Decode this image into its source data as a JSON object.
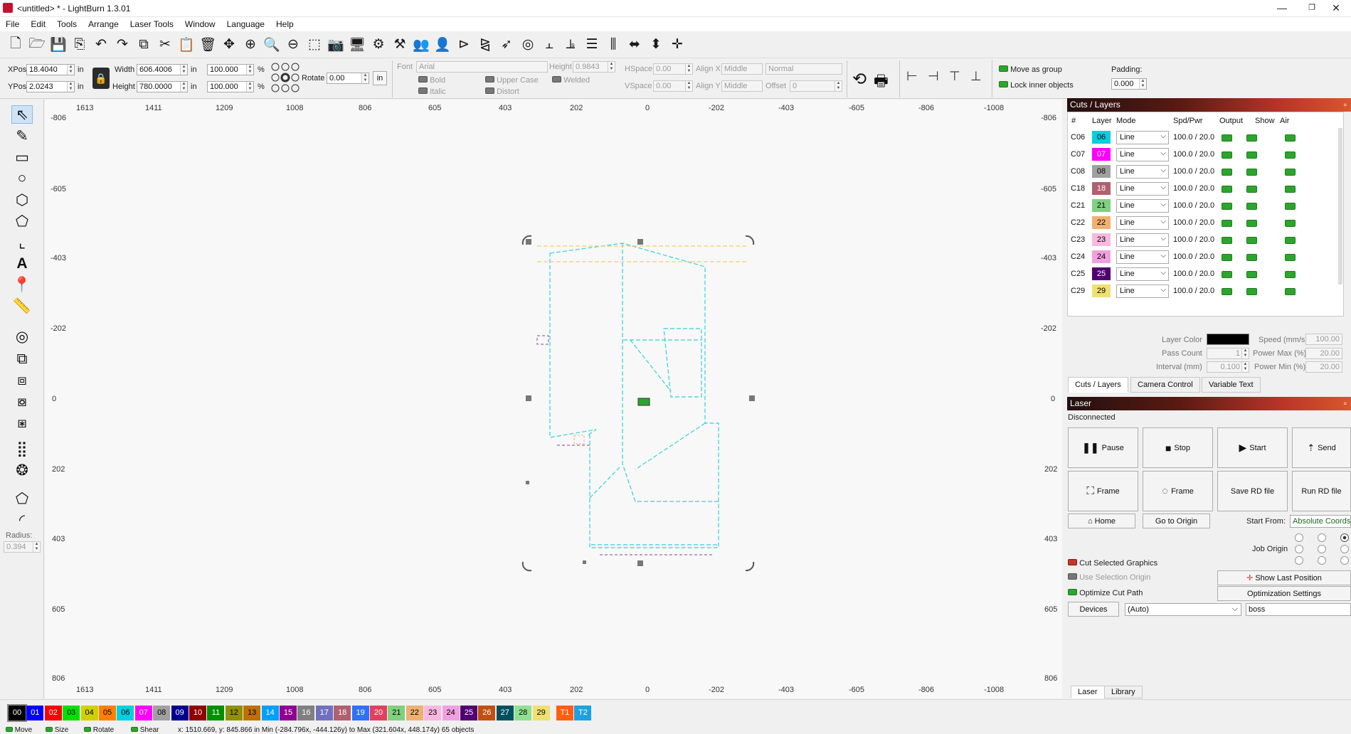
{
  "window": {
    "title": "<untitled> * - LightBurn 1.3.01",
    "minimize": "—",
    "maximize": "❐",
    "close": "✕"
  },
  "menu": [
    "File",
    "Edit",
    "Tools",
    "Arrange",
    "Laser Tools",
    "Window",
    "Language",
    "Help"
  ],
  "toolbar_icons": [
    "new-file-icon",
    "open-folder-icon",
    "save-icon",
    "export-icon",
    "undo-icon",
    "redo-icon",
    "copy-icon",
    "cut-icon",
    "paste-icon",
    "delete-icon",
    "move-icon",
    "zoom-fit-icon",
    "zoom-in-icon",
    "zoom-out-icon",
    "zoom-frame-icon",
    "camera-icon",
    "monitor-icon",
    "settings-icon",
    "tools-icon",
    "group-icon",
    "user-icon",
    "align-icon",
    "mirror-icon",
    "send-icon",
    "target-icon",
    "distribute-left-icon",
    "distribute-right-icon",
    "center-vertical-icon",
    "center-horizontal-icon",
    "equal-width-icon",
    "equal-height-icon",
    "nudge-icon"
  ],
  "props": {
    "xpos_label": "XPos",
    "xpos": "18.4040",
    "xpos_unit": "in",
    "ypos_label": "YPos",
    "ypos": "2.0243",
    "ypos_unit": "in",
    "width_label": "Width",
    "width": "606.4006",
    "width_unit": "in",
    "height_label": "Height",
    "height": "780.0000",
    "height_unit": "in",
    "scale_w": "100.000",
    "scale_h": "100.000",
    "pct": "%",
    "rotate_label": "Rotate",
    "rotate": "0.00",
    "rotate_unit": "in",
    "font_label": "Font",
    "font": "Arial",
    "fheight_label": "Height",
    "fheight": "0.9843",
    "hspace_label": "HSpace",
    "hspace": "0.00",
    "vspace_label": "VSpace",
    "vspace": "0.00",
    "alignx_label": "Align X",
    "alignx": "Middle",
    "aligny_label": "Align Y",
    "aligny": "Middle",
    "normal": "Normal",
    "offset_label": "Offset",
    "offset": "0",
    "bold": "Bold",
    "italic": "Italic",
    "upper": "Upper Case",
    "distort": "Distort",
    "welded": "Welded",
    "move_group": "Move as group",
    "lock_inner": "Lock inner objects",
    "padding_label": "Padding:",
    "padding": "0.000"
  },
  "rulers": {
    "top": [
      "1613",
      "1411",
      "1209",
      "1008",
      "806",
      "605",
      "403",
      "202",
      "0",
      "-202",
      "-403",
      "-605",
      "-806",
      "-1008"
    ],
    "left": [
      "-806",
      "-605",
      "-403",
      "-202",
      "0",
      "202",
      "403",
      "605",
      "806"
    ],
    "right": [
      "-806",
      "-605",
      "-403",
      "-202",
      "0",
      "202",
      "403",
      "605",
      "806"
    ]
  },
  "lefttools": {
    "radius_label": "Radius:",
    "radius": "0.394"
  },
  "cuts": {
    "title": "Cuts / Layers",
    "headers": [
      "#",
      "Layer",
      "Mode",
      "Spd/Pwr",
      "Output",
      "Show",
      "Air"
    ],
    "rows": [
      {
        "id": "C06",
        "num": "06",
        "color": "#00d0e0",
        "mode": "Line",
        "spd": "100.0 / 20.0"
      },
      {
        "id": "C07",
        "num": "07",
        "color": "#ff00ff",
        "mode": "Line",
        "spd": "100.0 / 20.0"
      },
      {
        "id": "C08",
        "num": "08",
        "color": "#a0a0a0",
        "mode": "Line",
        "spd": "100.0 / 20.0"
      },
      {
        "id": "C18",
        "num": "18",
        "color": "#b06070",
        "mode": "Line",
        "spd": "100.0 / 20.0"
      },
      {
        "id": "C21",
        "num": "21",
        "color": "#80d080",
        "mode": "Line",
        "spd": "100.0 / 20.0"
      },
      {
        "id": "C22",
        "num": "22",
        "color": "#f0b070",
        "mode": "Line",
        "spd": "100.0 / 20.0"
      },
      {
        "id": "C23",
        "num": "23",
        "color": "#f8b8e0",
        "mode": "Line",
        "spd": "100.0 / 20.0"
      },
      {
        "id": "C24",
        "num": "24",
        "color": "#f0a0e0",
        "mode": "Line",
        "spd": "100.0 / 20.0"
      },
      {
        "id": "C25",
        "num": "25",
        "color": "#500070",
        "mode": "Line",
        "spd": "100.0 / 20.0"
      },
      {
        "id": "C29",
        "num": "29",
        "color": "#f0e070",
        "mode": "Line",
        "spd": "100.0 / 20.0"
      }
    ],
    "layer_color_label": "Layer Color",
    "pass_label": "Pass Count",
    "pass": "1",
    "interval_label": "Interval (mm)",
    "interval": "0.100",
    "speed_label": "Speed (mm/s)",
    "speed": "100.00",
    "pmax_label": "Power Max (%)",
    "pmax": "20.00",
    "pmin_label": "Power Min (%)",
    "pmin": "20.00"
  },
  "tabs1": [
    "Cuts / Layers",
    "Camera Control",
    "Variable Text"
  ],
  "laser": {
    "title": "Laser",
    "status": "Disconnected",
    "pause": "Pause",
    "stop": "Stop",
    "start": "Start",
    "send": "Send",
    "frame1": "Frame",
    "frame2": "Frame",
    "save_rd": "Save RD file",
    "run_rd": "Run RD file",
    "home": "Home",
    "go_origin": "Go to Origin",
    "start_from_label": "Start From:",
    "start_from": "Absolute Coords",
    "job_origin": "Job Origin",
    "cut_selected": "Cut Selected Graphics",
    "use_sel_origin": "Use Selection Origin",
    "optimize": "Optimize Cut Path",
    "show_last": "Show Last Position",
    "opt_settings": "Optimization Settings",
    "devices": "Devices",
    "device_sel": "(Auto)",
    "device_name": "boss"
  },
  "tabs2": [
    "Laser",
    "Library"
  ],
  "palette": [
    {
      "n": "00",
      "c": "#000000",
      "t": "#fff"
    },
    {
      "n": "01",
      "c": "#0000ff",
      "t": "#fff"
    },
    {
      "n": "02",
      "c": "#ff0000",
      "t": "#fff"
    },
    {
      "n": "03",
      "c": "#00e000",
      "t": "#000"
    },
    {
      "n": "04",
      "c": "#d0d000",
      "t": "#000"
    },
    {
      "n": "05",
      "c": "#ff8000",
      "t": "#000"
    },
    {
      "n": "06",
      "c": "#00d0e0",
      "t": "#000"
    },
    {
      "n": "07",
      "c": "#ff00ff",
      "t": "#fff"
    },
    {
      "n": "08",
      "c": "#a0a0a0",
      "t": "#000"
    },
    {
      "n": "09",
      "c": "#000090",
      "t": "#fff"
    },
    {
      "n": "10",
      "c": "#900000",
      "t": "#fff"
    },
    {
      "n": "11",
      "c": "#009000",
      "t": "#fff"
    },
    {
      "n": "12",
      "c": "#909000",
      "t": "#000"
    },
    {
      "n": "13",
      "c": "#c07000",
      "t": "#000"
    },
    {
      "n": "14",
      "c": "#00a0ff",
      "t": "#fff"
    },
    {
      "n": "15",
      "c": "#900090",
      "t": "#fff"
    },
    {
      "n": "16",
      "c": "#808080",
      "t": "#fff"
    },
    {
      "n": "17",
      "c": "#7070c0",
      "t": "#fff"
    },
    {
      "n": "18",
      "c": "#b06070",
      "t": "#fff"
    },
    {
      "n": "19",
      "c": "#3070ff",
      "t": "#fff"
    },
    {
      "n": "20",
      "c": "#e04060",
      "t": "#fff"
    },
    {
      "n": "21",
      "c": "#80d080",
      "t": "#000"
    },
    {
      "n": "22",
      "c": "#f0b070",
      "t": "#000"
    },
    {
      "n": "23",
      "c": "#f8b8e0",
      "t": "#000"
    },
    {
      "n": "24",
      "c": "#f0a0e0",
      "t": "#000"
    },
    {
      "n": "25",
      "c": "#500070",
      "t": "#fff"
    },
    {
      "n": "26",
      "c": "#c05010",
      "t": "#fff"
    },
    {
      "n": "27",
      "c": "#005060",
      "t": "#fff"
    },
    {
      "n": "28",
      "c": "#90e090",
      "t": "#000"
    },
    {
      "n": "29",
      "c": "#f0e070",
      "t": "#000"
    },
    {
      "n": "T1",
      "c": "#ff6010",
      "t": "#fff"
    },
    {
      "n": "T2",
      "c": "#20a0e0",
      "t": "#fff"
    }
  ],
  "status": {
    "move": "Move",
    "size": "Size",
    "rotate": "Rotate",
    "shear": "Shear",
    "coords": "x: 1510.669, y: 845.866 in    Min (-284.796x, -444.126y) to Max (321.604x, 448.174y)   65 objects"
  }
}
